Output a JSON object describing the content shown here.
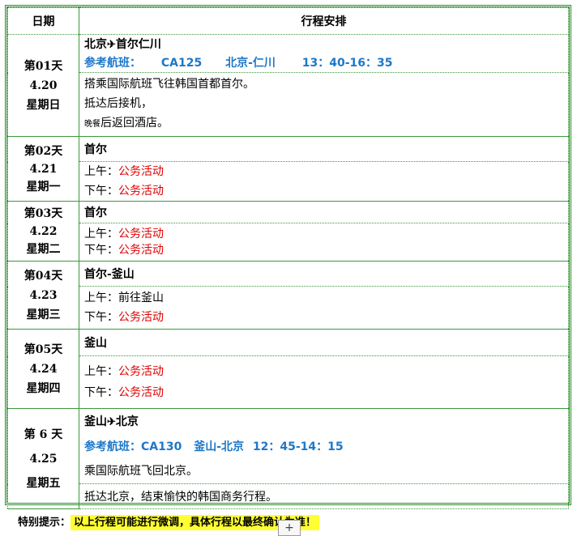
{
  "header": {
    "date_col": "日期",
    "plan_col": "行程安排"
  },
  "days": [
    {
      "day": "第01天",
      "date": "4.20",
      "weekday": "星期日",
      "title_from": "北京",
      "title_to": "首尔仁川",
      "plane": "✈",
      "flight": {
        "label": "参考航班：",
        "code": "CA125",
        "route": "北京-仁川",
        "time": "13：40-16：35"
      },
      "lines": [
        "搭乘国际航班飞往韩国首都首尔。",
        "抵达后接机，"
      ],
      "last_small": "晚餐",
      "last_rest": "后返回酒店。"
    },
    {
      "day": "第02天",
      "date": "4.21",
      "weekday": "星期一",
      "title": "首尔",
      "am_label": "上午：",
      "am": "公务活动",
      "pm_label": "下午：",
      "pm": "公务活动"
    },
    {
      "day": "第03天",
      "date": "4.22",
      "weekday": "星期二",
      "title": "首尔",
      "am_label": "上午：",
      "am": "公务活动",
      "pm_label": "下午：",
      "pm": "公务活动"
    },
    {
      "day": "第04天",
      "date": "4.23",
      "weekday": "星期三",
      "title": "首尔-釜山",
      "am_label": "上午：",
      "am": "前往釜山",
      "pm_label": "下午：",
      "pm": "公务活动"
    },
    {
      "day": "第05天",
      "date": "4.24",
      "weekday": "星期四",
      "title": "釜山",
      "am_label": "上午：",
      "am": "公务活动",
      "pm_label": "下午：",
      "pm": "公务活动"
    },
    {
      "day": "第 6 天",
      "date": "4.25",
      "weekday": "星期五",
      "title_from": "釜山",
      "title_to": "北京",
      "plane": "✈",
      "flight": {
        "label": "参考航班：",
        "code": "CA130",
        "route": "釜山-北京",
        "time": "12：45-14：15"
      },
      "line1": "乘国际航班飞回北京。",
      "line2": "抵达北京，结束愉快的韩国商务行程。"
    }
  ],
  "footer": {
    "label": "特别提示：",
    "text": "以上行程可能进行微调，具体行程以最终确认为准！",
    "plus": "+"
  },
  "colors": {
    "border": "#2e8b2e",
    "flight": "#1e78c8",
    "activity": "#e00000",
    "highlight": "#ffff33"
  }
}
